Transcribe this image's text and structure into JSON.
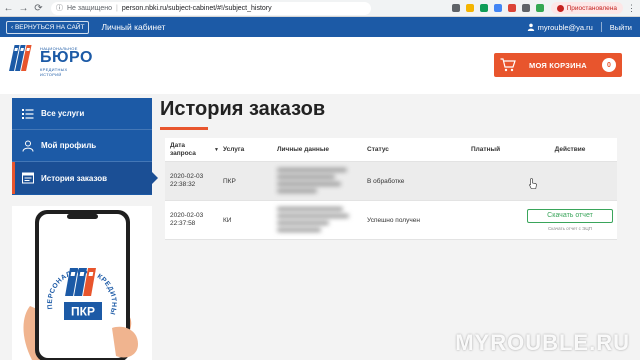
{
  "browser": {
    "nav": {
      "back": "←",
      "forward": "→",
      "reload": "⟳"
    },
    "security_label": "Не защищено",
    "url": "person.nbki.ru/subject-cabinet/#!/subject_history",
    "paused_label": "Приостановлена",
    "ext_colors": [
      "#5f6368",
      "#f4b400",
      "#0f9d58",
      "#4285f4",
      "#db4437",
      "#5f6368",
      "#34a853"
    ]
  },
  "topbar": {
    "back_label": "‹ ВЕРНУТЬСЯ НА САЙТ",
    "cabinet_label": "Личный кабинет",
    "email": "myrouble@ya.ru",
    "logout_label": "Выйти"
  },
  "logo": {
    "top_text": "НАЦИОНАЛЬНОЕ",
    "main_text": "БЮРО",
    "bottom_text": "КРЕДИТНЫХ ИСТОРИЙ"
  },
  "cart": {
    "label": "МОЯ КОРЗИНА",
    "count": "0"
  },
  "sidebar": {
    "items": [
      {
        "label": "Все услуги",
        "icon": "list-icon"
      },
      {
        "label": "Мой профиль",
        "icon": "user-icon"
      },
      {
        "label": "История заказов",
        "icon": "history-icon",
        "active": true
      }
    ]
  },
  "promo": {
    "ring_text": "ПЕРСОНАЛЬНЫЙ КРЕДИТНЫЙ РЕЙТИНГ",
    "badge_text": "ПКР"
  },
  "page": {
    "title": "История заказов"
  },
  "table": {
    "headers": {
      "date": "Дата запроса",
      "service": "Услуга",
      "personal": "Личные данные",
      "status": "Статус",
      "paid": "Платный",
      "action": "Действие"
    },
    "rows": [
      {
        "date": "2020-02-03",
        "time": "22:38:32",
        "service": "ПКР",
        "status": "В обработке",
        "paid": "",
        "action": ""
      },
      {
        "date": "2020-02-03",
        "time": "22:37:58",
        "service": "КИ",
        "status": "Успешно получен",
        "paid": "",
        "action": "Скачать отчет",
        "note": "Скачать отчет с ЭЦП"
      }
    ]
  },
  "watermark": "MYROUBLE.RU",
  "colors": {
    "brand_blue": "#1c5aa6",
    "accent_orange": "#e8552d",
    "success_green": "#3aa55b"
  }
}
